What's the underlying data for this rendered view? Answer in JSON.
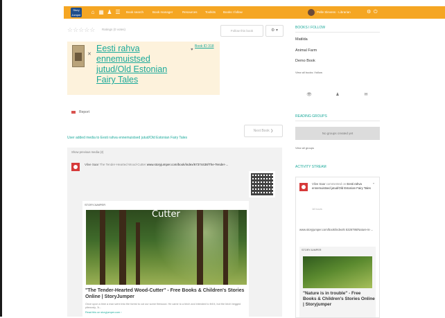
{
  "topbar": {
    "logo_text": "Story Jumper",
    "nav": [
      {
        "icon": "home-icon",
        "glyph": "⌂"
      },
      {
        "icon": "grid-icon",
        "glyph": "▦"
      },
      {
        "icon": "user-icon",
        "glyph": "♟"
      },
      {
        "icon": "list-icon",
        "glyph": "☰"
      }
    ],
    "links": [
      "Book search",
      "Book manager",
      "Resources",
      "Toolkits",
      "Books I follow"
    ],
    "user_name": "Pelle Slevens - Librarian",
    "user_icons": [
      {
        "icon": "settings-icon",
        "glyph": "⚙"
      },
      {
        "icon": "power-icon",
        "glyph": "⏻"
      }
    ]
  },
  "rating": {
    "stars": "☆☆☆☆☆",
    "text": "Ratings (0 votes)"
  },
  "actions": {
    "follow_label": "Follow this book",
    "gear_label": "⚙ ▾"
  },
  "book": {
    "title": "Eesti rahva ennemuistsed jutud/Old Estonian Fairy Tales",
    "close_glyph": "✕",
    "id_glyph": "♥",
    "id_text": "Book ID 318"
  },
  "report": {
    "label": "Report"
  },
  "feed": {
    "next_label": "Next Book ❯",
    "added_text": "User added media to Eesti rahva ennemuistsed jutud/Old Estonian Fairy Tales",
    "prev_media": "Show previous media (2)",
    "post_user": "Vilve Saar",
    "post_text": "The Tender-Hearted Wood-Cutter",
    "post_link": "www.storyjumper.com/book/index/67374438/The-Tender-...",
    "source_label": "STORYJUMPER",
    "image_caption": "Cutter",
    "media_title": "\"The Tender-Hearted Wood-Cutter\" - Free Books & Children's Stories Online | StoryJumper",
    "media_desc": "Once upon a time a man went into the forest to cut our some firewood. He came to a birch and intended to fell it, but the birch begged piteously, 'A...",
    "media_more": "Read this on storyjumper.com ›"
  },
  "sidebar": {
    "books_heading": "BOOKS I FOLLOW",
    "books": [
      "Matilda",
      "Animal Farm",
      "Demo Book"
    ],
    "view_all_books": "View all books I follow",
    "icons": [
      {
        "icon": "eye-icon",
        "glyph": "👁"
      },
      {
        "icon": "users-icon",
        "glyph": "♟"
      },
      {
        "icon": "message-icon",
        "glyph": "✉"
      }
    ],
    "groups_heading": "READING GROUPS",
    "no_groups": "No groups created yet",
    "view_all_groups": "View all groups",
    "activity_heading": "ACTIVITY STREAM",
    "activity": {
      "user": "Vilve Saar",
      "verb": "commented on",
      "book": "Eesti rahva ennemuistsed jutud/Old Estonian Fairy Tales",
      "time": "18 hours",
      "caret": "▾",
      "link": "www.storyjumper.com/book/index/6 5326795/Nature-is-...",
      "source_label": "STORYJUMPER",
      "media_title": "\"Nature is in trouble\" - Free Books & Children's Stories Online | Storyjumper"
    }
  },
  "colors": {
    "topbar": "#f5a623",
    "accent": "#1aa99a",
    "book_card": "#fdf2dc",
    "report": "#d9534f"
  }
}
